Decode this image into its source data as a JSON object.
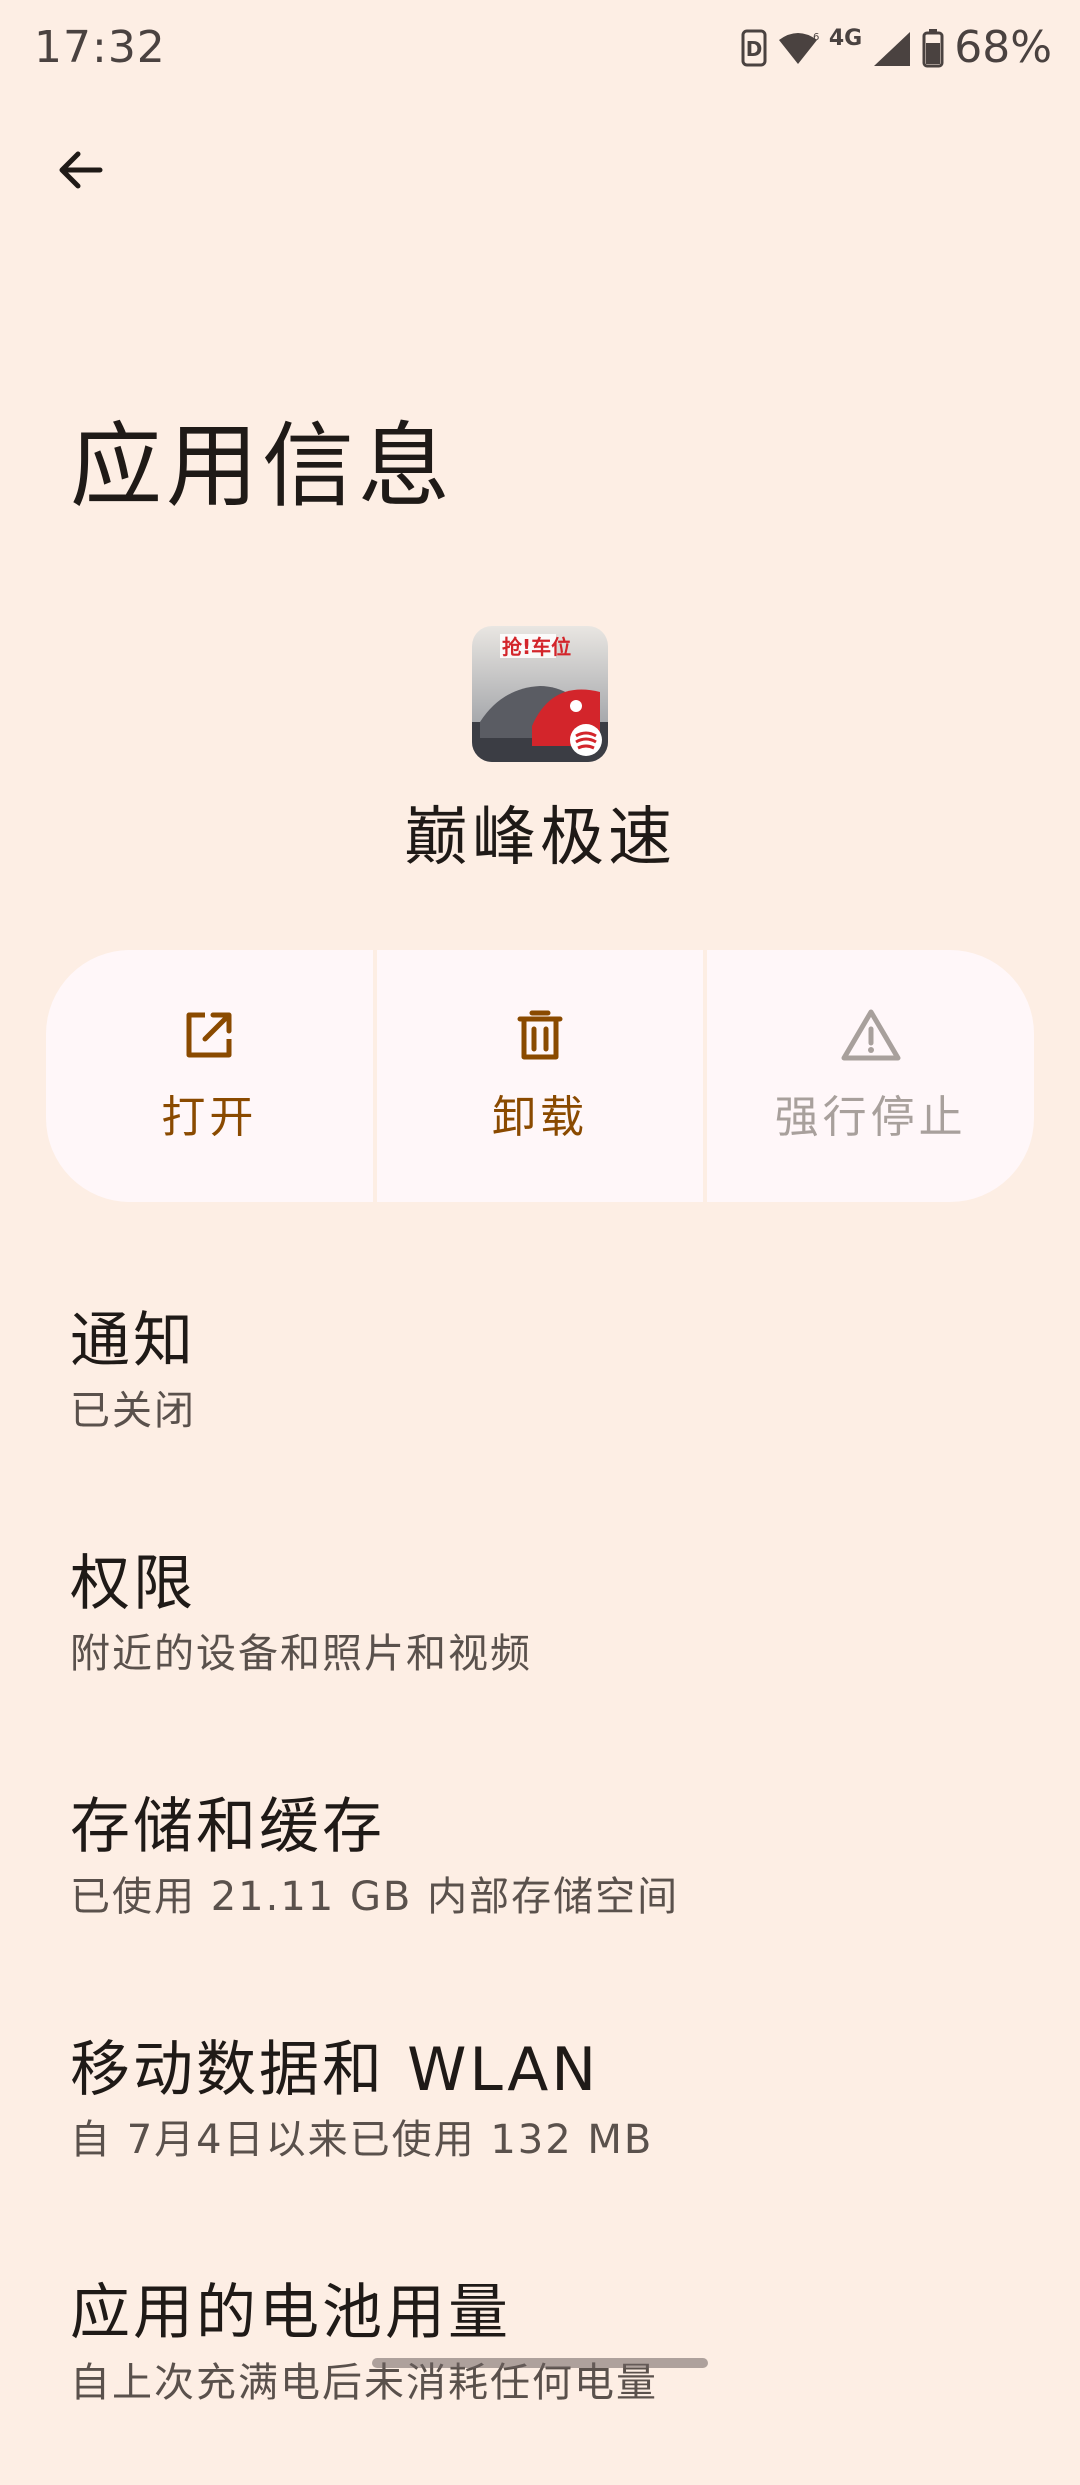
{
  "status_bar": {
    "time": "17:32",
    "network": "4G",
    "battery": "68%",
    "icons": [
      "hd-icon",
      "wifi-icon",
      "cell-signal-icon",
      "battery-icon"
    ]
  },
  "header": {
    "back_icon": "arrow-left-icon",
    "title": "应用信息"
  },
  "app": {
    "name": "巅峰极速",
    "icon_text": "抢!车位"
  },
  "actions": [
    {
      "label": "打开",
      "icon": "open-external-icon",
      "enabled": true
    },
    {
      "label": "卸载",
      "icon": "trash-icon",
      "enabled": true
    },
    {
      "label": "强行停止",
      "icon": "warning-triangle-icon",
      "enabled": false
    }
  ],
  "colors": {
    "background": "#fdeee4",
    "card": "#fff7f9",
    "accent": "#8a4a00",
    "disabled": "#a8a09c"
  },
  "settings": [
    {
      "title": "通知",
      "summary": "已关闭"
    },
    {
      "title": "权限",
      "summary": "附近的设备和照片和视频"
    },
    {
      "title": "存储和缓存",
      "summary": "已使用 21.11 GB 内部存储空间"
    },
    {
      "title": "移动数据和 WLAN",
      "summary": "自 7月4日以来已使用 132 MB"
    },
    {
      "title": "应用的电池用量",
      "summary": "自上次充满电后未消耗任何电量"
    }
  ]
}
